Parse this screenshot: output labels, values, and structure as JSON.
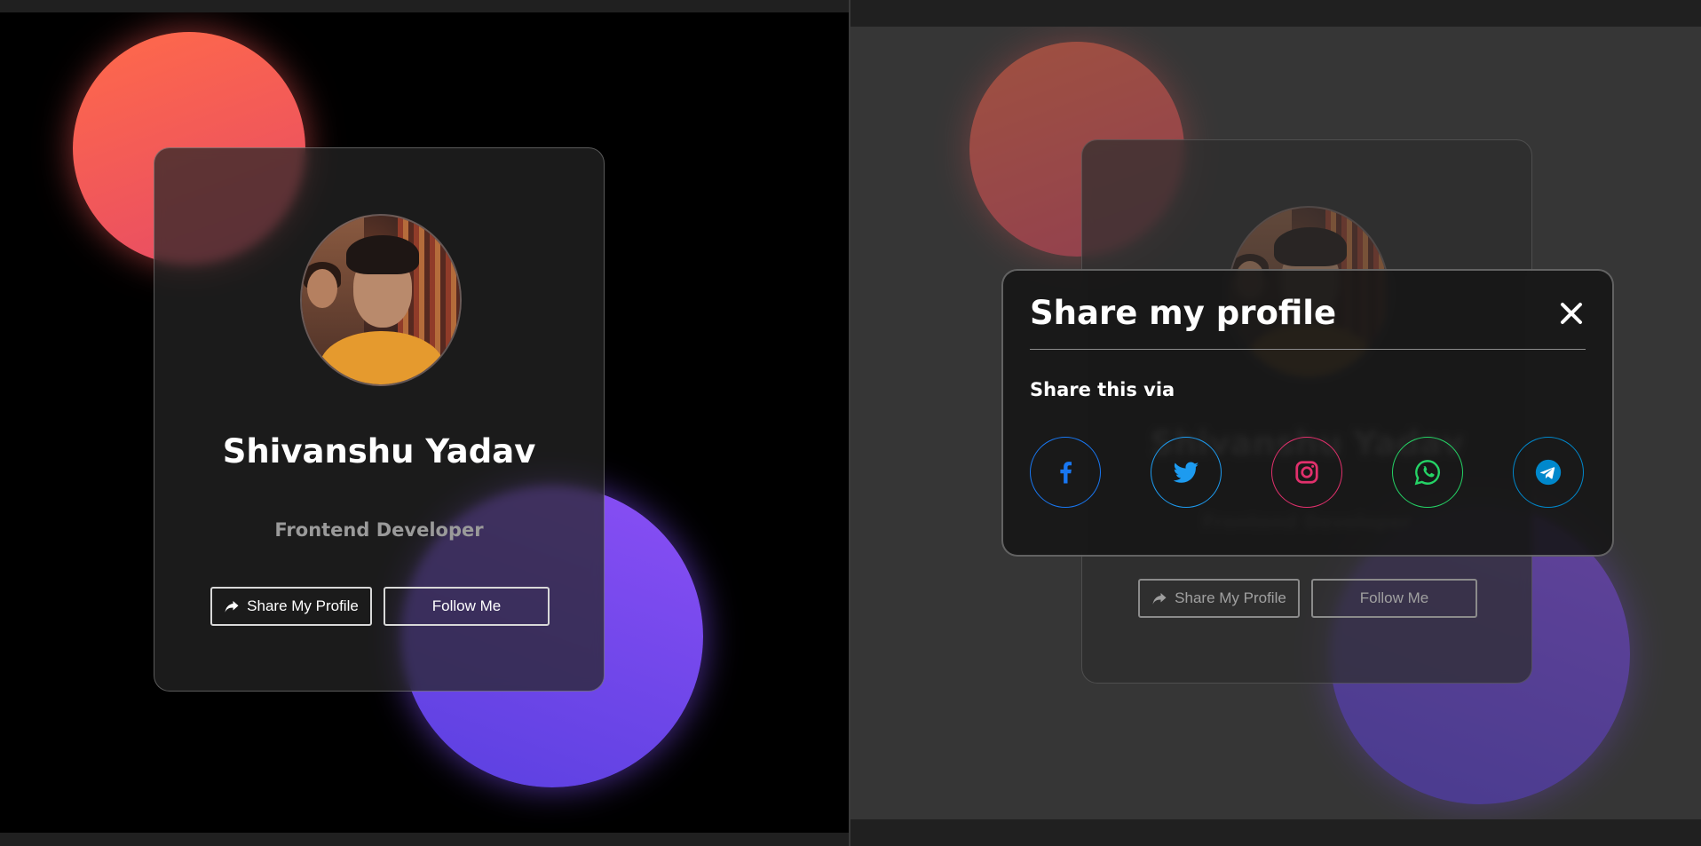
{
  "profile": {
    "name": "Shivanshu Yadav",
    "role": "Frontend Developer",
    "share_button_label": "Share My Profile",
    "follow_button_label": "Follow Me"
  },
  "modal": {
    "title": "Share my profile",
    "close_icon": "close-icon",
    "subtitle": "Share this via",
    "socials": [
      {
        "name": "Facebook",
        "icon": "facebook-icon",
        "color": "#1877f2"
      },
      {
        "name": "Twitter",
        "icon": "twitter-icon",
        "color": "#1d9bf0"
      },
      {
        "name": "Instagram",
        "icon": "instagram-icon",
        "color": "#e1306c"
      },
      {
        "name": "WhatsApp",
        "icon": "whatsapp-icon",
        "color": "#25d366"
      },
      {
        "name": "Telegram",
        "icon": "telegram-icon",
        "color": "#0088cc"
      }
    ]
  },
  "colors": {
    "orange_blob": "#ff6a4a",
    "purple_blob": "#6a45e8",
    "background_left": "#000000",
    "background_right": "#373737"
  }
}
